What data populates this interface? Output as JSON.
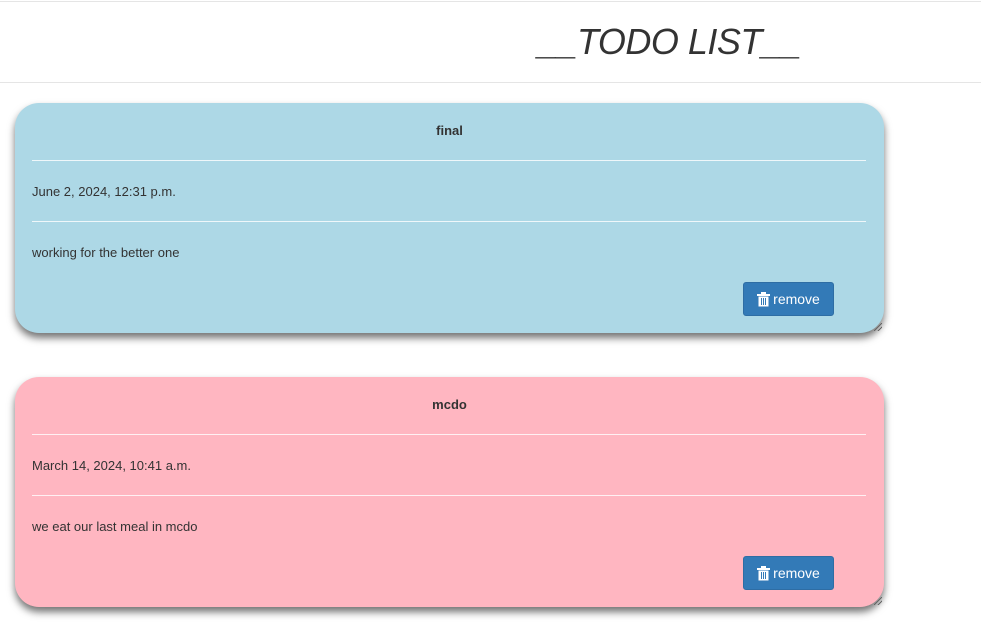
{
  "header": {
    "title": "__TODO LIST__"
  },
  "todos": [
    {
      "name": "final",
      "date": "June 2, 2024, 12:31 p.m.",
      "description": "working for the better one",
      "remove_label": "remove",
      "color": "#add8e6"
    },
    {
      "name": "mcdo",
      "date": "March 14, 2024, 10:41 a.m.",
      "description": "we eat our last meal in mcdo",
      "remove_label": "remove",
      "color": "#ffb6c1"
    }
  ],
  "icons": {
    "remove": "trash-icon"
  }
}
